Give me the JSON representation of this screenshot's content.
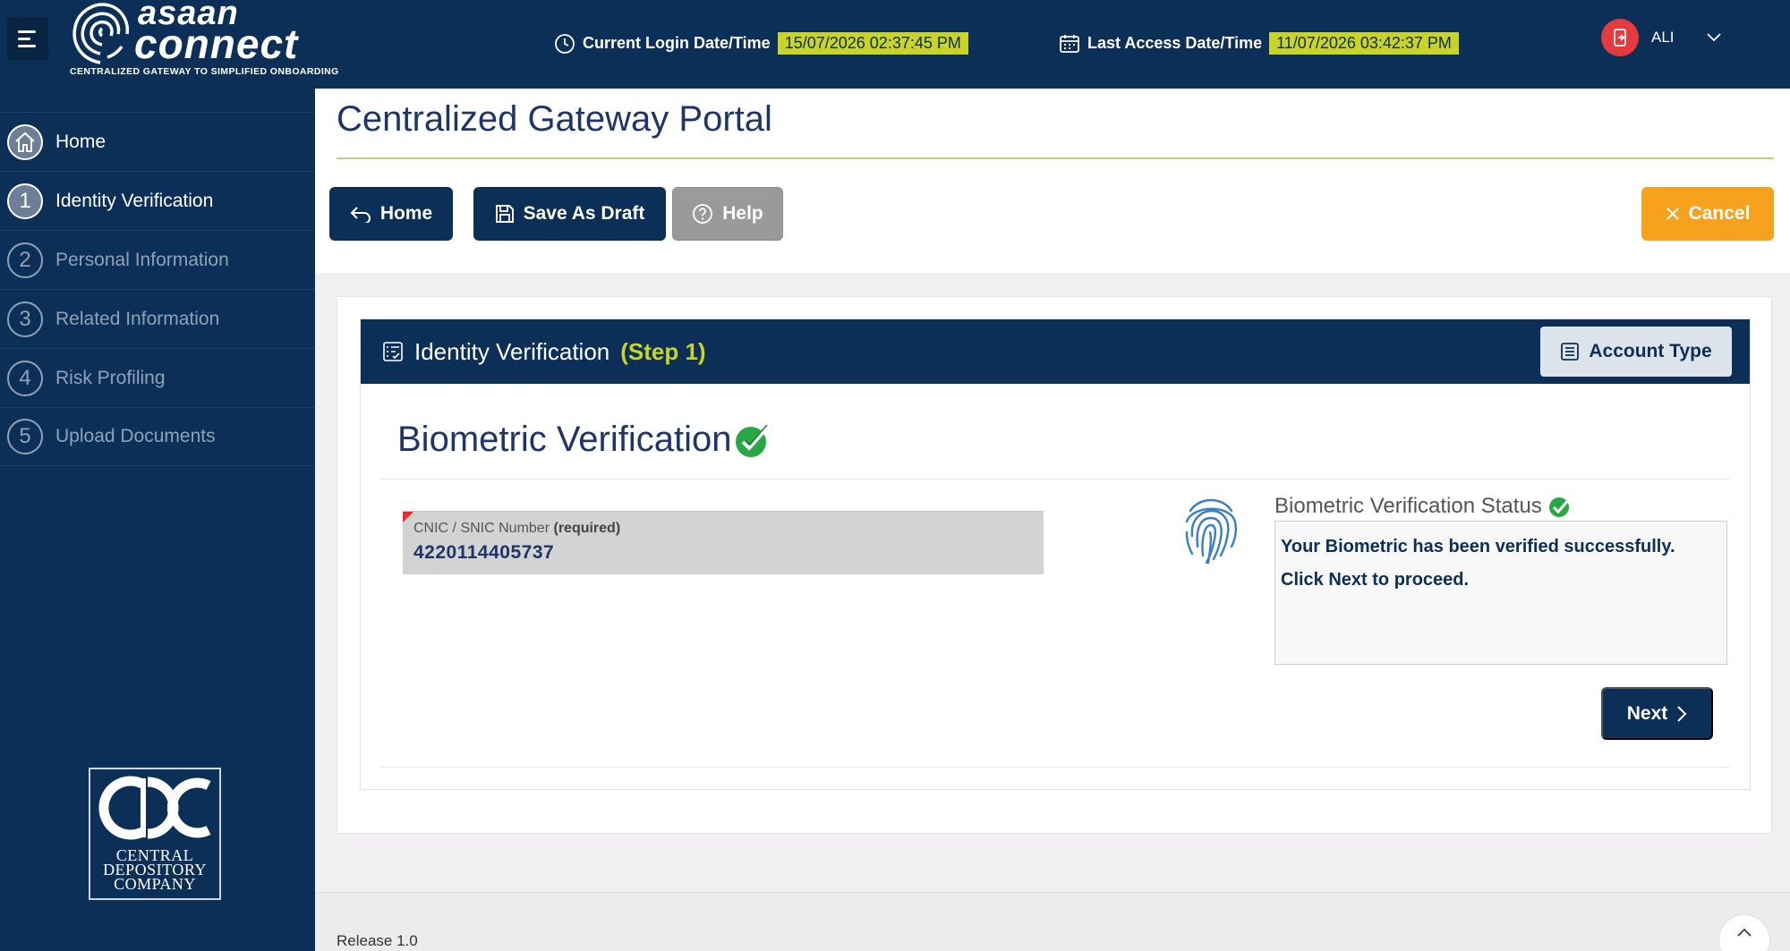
{
  "header": {
    "logo_top": "asaan",
    "logo_bottom": "connect",
    "logo_tagline": "CENTRALIZED GATEWAY TO SIMPLIFIED ONBOARDING",
    "login_label": "Current Login Date/Time",
    "login_value": "15/07/2026 02:37:45 PM",
    "last_access_label": "Last Access Date/Time",
    "last_access_value": "11/07/2026 03:42:37 PM",
    "user_name": "ALI"
  },
  "sidebar": {
    "items": [
      {
        "num": "",
        "label": "Home",
        "icon": "house-icon"
      },
      {
        "num": "1",
        "label": "Identity Verification",
        "active": true
      },
      {
        "num": "2",
        "label": "Personal Information"
      },
      {
        "num": "3",
        "label": "Related Information"
      },
      {
        "num": "4",
        "label": "Risk Profiling"
      },
      {
        "num": "5",
        "label": "Upload Documents"
      }
    ],
    "company_logo_text": [
      "CENTRAL",
      "DEPOSITORY",
      "COMPANY"
    ]
  },
  "page": {
    "title": "Centralized Gateway Portal",
    "toolbar": {
      "home_label": "Home",
      "draft_label": "Save As Draft",
      "help_label": "Help",
      "cancel_label": "Cancel"
    }
  },
  "panel": {
    "title": "Identity Verification",
    "step": "(Step 1)",
    "account_type_label": "Account Type",
    "section_title": "Biometric Verification",
    "cnic_label": "CNIC / SNIC Number",
    "cnic_required": "(required)",
    "cnic_value": "4220114405737",
    "status_label": "Biometric Verification Status",
    "status_line1": "Your Biometric has been verified successfully.",
    "status_line2": "Click Next to proceed.",
    "next_label": "Next"
  },
  "footer": {
    "release": "Release 1.0"
  },
  "colors": {
    "navy": "#0b2f57",
    "highlight": "#c9d32a",
    "cancel": "#f7a21c",
    "success": "#27a844"
  }
}
